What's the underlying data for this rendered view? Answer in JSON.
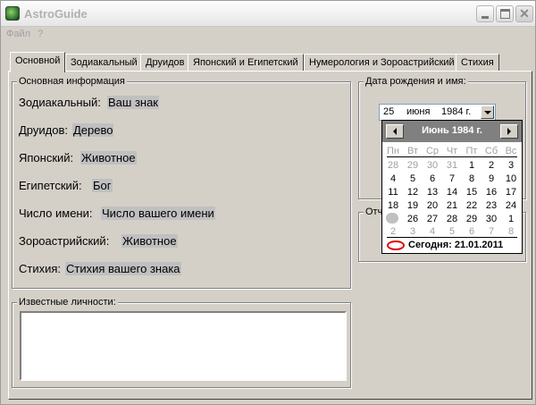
{
  "window": {
    "title": "AstroGuide"
  },
  "menu": {
    "file": "Файл",
    "help": "?"
  },
  "tabs": [
    {
      "label": "Основной"
    },
    {
      "label": "Зодиакальный"
    },
    {
      "label": "Друидов"
    },
    {
      "label": "Японский и Египетский"
    },
    {
      "label": "Нумерология и Зороастрийский"
    },
    {
      "label": "Стихия"
    }
  ],
  "main_info": {
    "title": "Основная информация",
    "rows": [
      {
        "label": "Зодиакальный:",
        "value": "Ваш знак"
      },
      {
        "label": "Друидов:",
        "value": "Дерево"
      },
      {
        "label": "Японский:",
        "value": "Животное"
      },
      {
        "label": "Египетский:",
        "value": "Бог"
      },
      {
        "label": "Число имени:",
        "value": "Число вашего имени"
      },
      {
        "label": "Зороастрийский:",
        "value": "Животное"
      },
      {
        "label": "Стихия:",
        "value": "Стихия вашего знака"
      }
    ]
  },
  "famous": {
    "title": "Известные личности:"
  },
  "birth": {
    "title": "Дата рождения и имя:",
    "day": "25",
    "month": "июня",
    "year": "1984 г."
  },
  "second_group": {
    "title": "Отч"
  },
  "calendar": {
    "title": "Июнь 1984 г.",
    "weekdays": [
      "Пн",
      "Вт",
      "Ср",
      "Чт",
      "Пт",
      "Сб",
      "Вс"
    ],
    "weeks": [
      [
        "28",
        "29",
        "30",
        "31",
        "1",
        "2",
        "3"
      ],
      [
        "4",
        "5",
        "6",
        "7",
        "8",
        "9",
        "10"
      ],
      [
        "11",
        "12",
        "13",
        "14",
        "15",
        "16",
        "17"
      ],
      [
        "18",
        "19",
        "20",
        "21",
        "22",
        "23",
        "24"
      ],
      [
        "",
        "26",
        "27",
        "28",
        "29",
        "30",
        "1"
      ],
      [
        "2",
        "3",
        "4",
        "5",
        "6",
        "7",
        "8"
      ]
    ],
    "today_label": "Сегодня: 21.01.2011"
  }
}
